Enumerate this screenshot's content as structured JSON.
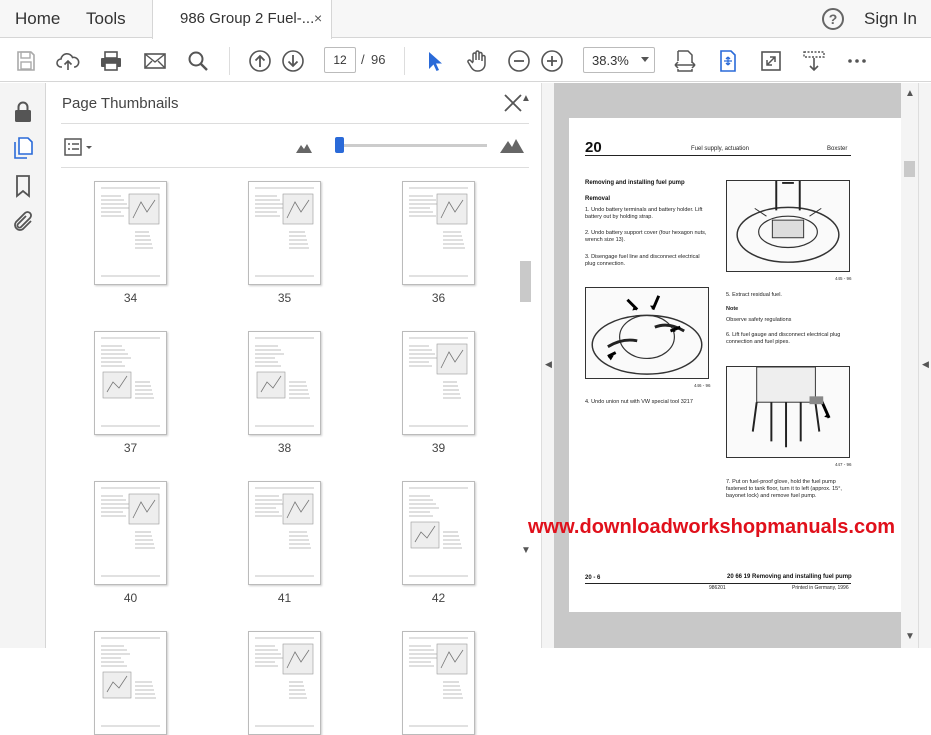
{
  "menubar": {
    "home": "Home",
    "tools": "Tools",
    "tab_title": "986 Group 2 Fuel-...",
    "tab_close": "×",
    "help": "?",
    "sign_in": "Sign In"
  },
  "toolbar": {
    "current_page": "12",
    "page_separator": "/",
    "total_pages": "96",
    "zoom": "38.3%",
    "icons": [
      "save-icon",
      "cloud-upload-icon",
      "print-icon",
      "mail-icon",
      "search-icon",
      "page-up-icon",
      "page-down-icon",
      "select-arrow-icon",
      "hand-icon",
      "zoom-out-icon",
      "zoom-in-icon",
      "fit-page-icon",
      "rotate-view-icon",
      "fullscreen-icon",
      "scroll-mode-icon",
      "more-icon"
    ],
    "accent": "#2a6ad8"
  },
  "sidebar": {
    "rail_icons": [
      "lock-icon",
      "pages-icon",
      "bookmark-icon",
      "attachment-icon"
    ]
  },
  "thumbnails_panel": {
    "title": "Page Thumbnails",
    "thumbnail_size_fraction": 0.02,
    "thumbnails": [
      {
        "label": "34"
      },
      {
        "label": "35"
      },
      {
        "label": "36"
      },
      {
        "label": "37"
      },
      {
        "label": "38"
      },
      {
        "label": "39"
      },
      {
        "label": "40"
      },
      {
        "label": "41"
      },
      {
        "label": "42"
      },
      {
        "label": ""
      },
      {
        "label": ""
      },
      {
        "label": ""
      }
    ]
  },
  "document_page": {
    "chapter": "20",
    "header_mid": "Fuel supply, actuation",
    "header_right": "Boxster",
    "section_title": "Removing and installing fuel pump",
    "sub_heading": "Removal",
    "steps_left": [
      "1. Undo battery terminals and battery holder. Lift battery out by holding strap.",
      "2. Undo battery support cover (four hexagon nuts, wrench size 13).",
      "3. Disengage fuel line and disconnect electrical plug connection."
    ],
    "fig1_caption": "445 - 96",
    "fig2_caption": "446 - 96",
    "fig3_caption": "447 - 96",
    "step4": "4. Undo union nut with VW special tool 3217",
    "step5": "5. Extract residual fuel.",
    "note_heading": "Note",
    "note_text": "Observe safety regulations",
    "step6": "6. Lift fuel gauge and disconnect electrical plug connection and fuel pipes.",
    "step7": "7. Put on fuel-proof glove, hold the fuel pump fastened to tank floor, turn it to left (approx. 15°, bayonet lock) and remove fuel pump.",
    "footer_left": "20 - 6",
    "footer_right": "20 66 19 Removing and installing fuel pump",
    "footer_code": "986201",
    "footer_print": "Printed in Germany, 1996"
  },
  "watermark": {
    "text": "www.downloadworkshopmanuals.com",
    "color": "#e0101b"
  }
}
